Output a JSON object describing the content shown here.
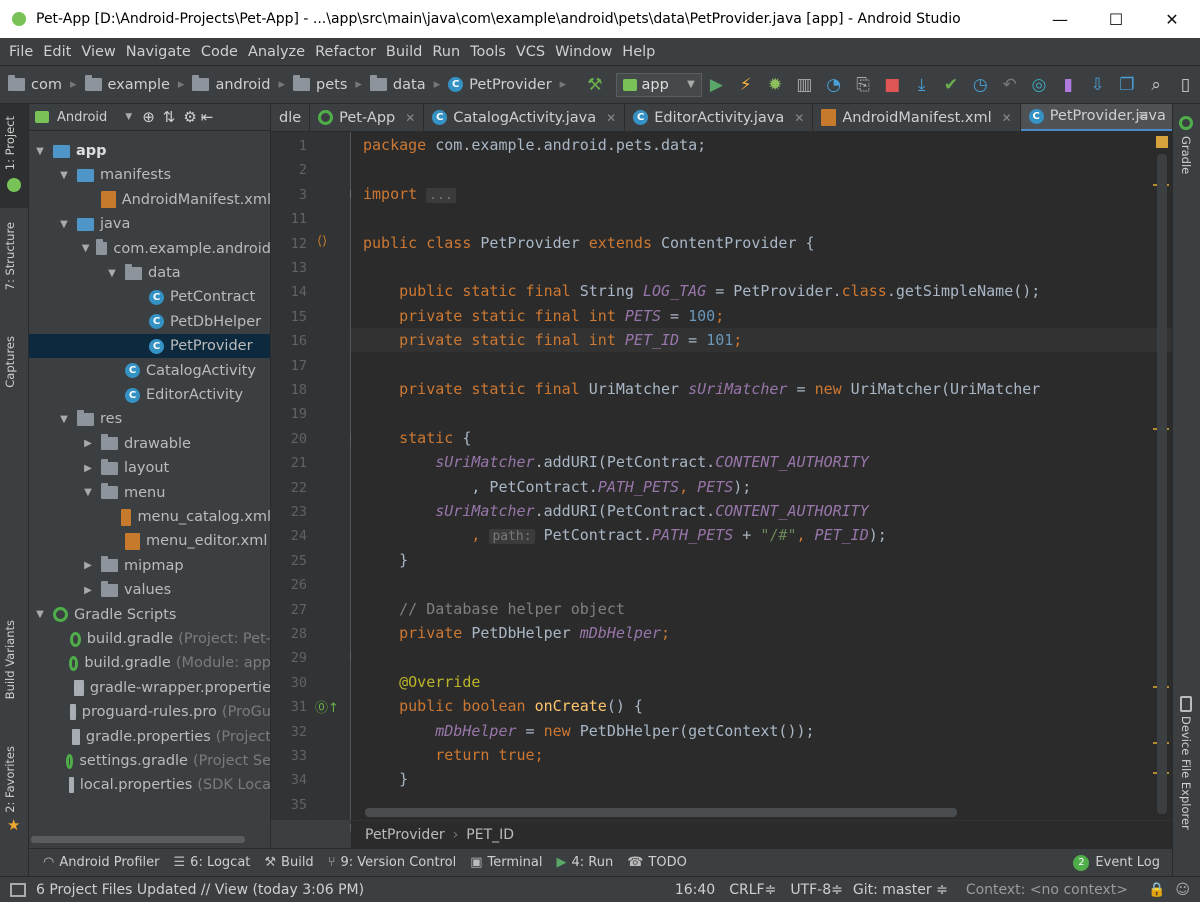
{
  "window": {
    "title": "Pet-App [D:\\Android-Projects\\Pet-App] - ...\\app\\src\\main\\java\\com\\example\\android\\pets\\data\\PetProvider.java [app] - Android Studio",
    "min": "—",
    "max": "☐",
    "close": "✕"
  },
  "menu": [
    "File",
    "Edit",
    "View",
    "Navigate",
    "Code",
    "Analyze",
    "Refactor",
    "Build",
    "Run",
    "Tools",
    "VCS",
    "Window",
    "Help"
  ],
  "nav": {
    "crumbs": [
      "com",
      "example",
      "android",
      "pets",
      "data"
    ],
    "file": "PetProvider",
    "run_config": "app"
  },
  "project_panel": {
    "view": "Android",
    "tree": [
      {
        "label": "app",
        "depth": 0,
        "expand": "▼",
        "icon": "folder-blue",
        "bold": true
      },
      {
        "label": "manifests",
        "depth": 1,
        "expand": "▼",
        "icon": "folder-blue"
      },
      {
        "label": "AndroidManifest.xml",
        "depth": 2,
        "expand": "",
        "icon": "xml"
      },
      {
        "label": "java",
        "depth": 1,
        "expand": "▼",
        "icon": "folder-blue"
      },
      {
        "label": "com.example.android",
        "depth": 2,
        "expand": "▼",
        "icon": "package"
      },
      {
        "label": "data",
        "depth": 3,
        "expand": "▼",
        "icon": "package"
      },
      {
        "label": "PetContract",
        "depth": 4,
        "expand": "",
        "icon": "class"
      },
      {
        "label": "PetDbHelper",
        "depth": 4,
        "expand": "",
        "icon": "class"
      },
      {
        "label": "PetProvider",
        "depth": 4,
        "expand": "",
        "icon": "class",
        "selected": true
      },
      {
        "label": "CatalogActivity",
        "depth": 3,
        "expand": "",
        "icon": "class"
      },
      {
        "label": "EditorActivity",
        "depth": 3,
        "expand": "",
        "icon": "class"
      },
      {
        "label": "res",
        "depth": 1,
        "expand": "▼",
        "icon": "folder-gray"
      },
      {
        "label": "drawable",
        "depth": 2,
        "expand": "▶",
        "icon": "folder-gray"
      },
      {
        "label": "layout",
        "depth": 2,
        "expand": "▶",
        "icon": "folder-gray"
      },
      {
        "label": "menu",
        "depth": 2,
        "expand": "▼",
        "icon": "folder-gray"
      },
      {
        "label": "menu_catalog.xml",
        "depth": 3,
        "expand": "",
        "icon": "xml"
      },
      {
        "label": "menu_editor.xml",
        "depth": 3,
        "expand": "",
        "icon": "xml"
      },
      {
        "label": "mipmap",
        "depth": 2,
        "expand": "▶",
        "icon": "folder-gray"
      },
      {
        "label": "values",
        "depth": 2,
        "expand": "▶",
        "icon": "folder-gray"
      },
      {
        "label": "Gradle Scripts",
        "depth": 0,
        "expand": "▼",
        "icon": "gradle"
      },
      {
        "label": "build.gradle",
        "depth": 1,
        "expand": "",
        "icon": "gradle",
        "note": "(Project: Pet-"
      },
      {
        "label": "build.gradle",
        "depth": 1,
        "expand": "",
        "icon": "gradle",
        "note": "(Module: app"
      },
      {
        "label": "gradle-wrapper.propertie",
        "depth": 1,
        "expand": "",
        "icon": "file"
      },
      {
        "label": "proguard-rules.pro",
        "depth": 1,
        "expand": "",
        "icon": "file",
        "note": "(ProGu"
      },
      {
        "label": "gradle.properties",
        "depth": 1,
        "expand": "",
        "icon": "file",
        "note": "(Project"
      },
      {
        "label": "settings.gradle",
        "depth": 1,
        "expand": "",
        "icon": "gradle",
        "note": "(Project Se"
      },
      {
        "label": "local.properties",
        "depth": 1,
        "expand": "",
        "icon": "file",
        "note": "(SDK Loca"
      }
    ]
  },
  "tabs": [
    {
      "label": "dle",
      "active": false,
      "icon": "none",
      "close": false
    },
    {
      "label": "Pet-App",
      "active": false,
      "icon": "gradle",
      "close": true
    },
    {
      "label": "CatalogActivity.java",
      "active": false,
      "icon": "class",
      "close": true
    },
    {
      "label": "EditorActivity.java",
      "active": false,
      "icon": "class",
      "close": true
    },
    {
      "label": "AndroidManifest.xml",
      "active": false,
      "icon": "xml",
      "close": true
    },
    {
      "label": "PetProvider.java",
      "active": true,
      "icon": "class",
      "close": true
    }
  ],
  "tab_overflow": "≡",
  "line_numbers": [
    "1",
    "2",
    "3",
    "11",
    "12",
    "13",
    "14",
    "15",
    "16",
    "17",
    "18",
    "19",
    "20",
    "21",
    "22",
    "23",
    "24",
    "25",
    "26",
    "27",
    "28",
    "29",
    "30",
    "31",
    "32",
    "33",
    "34",
    "35"
  ],
  "code": {
    "l1": {
      "kw": "package",
      "rest": " com.example.android.pets.data;"
    },
    "l3": {
      "kw": "import",
      "fold": "..."
    },
    "l12": {
      "a": "public class",
      "b": " PetProvider ",
      "c": "extends",
      "d": " ContentProvider {"
    },
    "l14": {
      "a": "    public static final",
      "b": " String ",
      "c": "LOG_TAG",
      "d": " = PetProvider.",
      "e": "class",
      ".f": "",
      "f": ".getSimpleName();"
    },
    "l15": {
      "a": "    private static final int",
      "c": "PETS",
      "d": " = ",
      "n": "100",
      "e": ";"
    },
    "l16": {
      "a": "    private static final int",
      "c": "PET_ID",
      "d": " = ",
      "n": "101",
      "e": ";"
    },
    "l17": {
      "a": "    private static final",
      "b": " UriMatcher ",
      "c": "sUriMatcher",
      "d": " = ",
      "e": "new",
      "f": " UriMatcher(UriMatcher"
    },
    "l20": {
      "a": "    static",
      "b": " {"
    },
    "l21": {
      "c": "sUriMatcher",
      "b": ".addURI(PetContract.",
      "d": "CONTENT_AUTHORITY"
    },
    "l22": {
      "b": "            , PetContract.",
      "d": "PATH_PETS",
      "e": ", ",
      "f": "PETS",
      "g": ");"
    },
    "l23": {
      "c": "sUriMatcher",
      "b": ".addURI(PetContract.",
      "d": "CONTENT_AUTHORITY"
    },
    "l24": {
      "a": "            , ",
      "hint": "path:",
      "b": " PetContract.",
      "d": "PATH_PETS",
      "e": " + ",
      "s": "\"/#\"",
      "f": ", ",
      "g": "PET_ID",
      "h": ");"
    },
    "l25": {
      "b": "    }"
    },
    "l27": {
      "cm": "    // Database helper object"
    },
    "l28": {
      "a": "    private",
      "b": " PetDbHelper ",
      "c": "mDbHelper",
      "d": ";"
    },
    "l30": {
      "ann": "    @Override"
    },
    "l31": {
      "a": "    public boolean",
      "fn": " onCreate",
      "b": "() {"
    },
    "l32": {
      "c": "mDbHelper",
      "b": " = ",
      "a": "new",
      "d": " PetDbHelper(getContext());"
    },
    "l33": {
      "a": "        return true",
      "b": ";"
    },
    "l34": {
      "b": "    }"
    }
  },
  "editor_breadcrumb": [
    "PetProvider",
    "PET_ID"
  ],
  "left_strip": [
    "1: Project",
    "7: Structure",
    "Captures",
    "Build Variants",
    "2: Favorites"
  ],
  "right_strip": [
    "Gradle",
    "Device File Explorer"
  ],
  "tool_windows": [
    {
      "label": "Android Profiler",
      "icon": "profiler-icon"
    },
    {
      "label": "6: Logcat",
      "icon": "logcat-icon"
    },
    {
      "label": "Build",
      "icon": "build-icon"
    },
    {
      "label": "9: Version Control",
      "icon": "vcs-icon"
    },
    {
      "label": "Terminal",
      "icon": "terminal-icon"
    },
    {
      "label": "4: Run",
      "icon": "run-icon"
    },
    {
      "label": "TODO",
      "icon": "todo-icon"
    }
  ],
  "event_log": {
    "count": "2",
    "label": "Event Log"
  },
  "status": {
    "message": "6 Project Files Updated // View (today 3:06 PM)",
    "position": "16:40",
    "line_sep": "CRLF≑",
    "encoding": "UTF-8≑",
    "git": "Git: master ≑",
    "context": "Context: <no context>"
  },
  "colors": {
    "keyword": "#cc7832",
    "number": "#6897bb",
    "field": "#9876aa",
    "string": "#6a8759",
    "comment": "#808080",
    "selection": "#0d293e"
  }
}
